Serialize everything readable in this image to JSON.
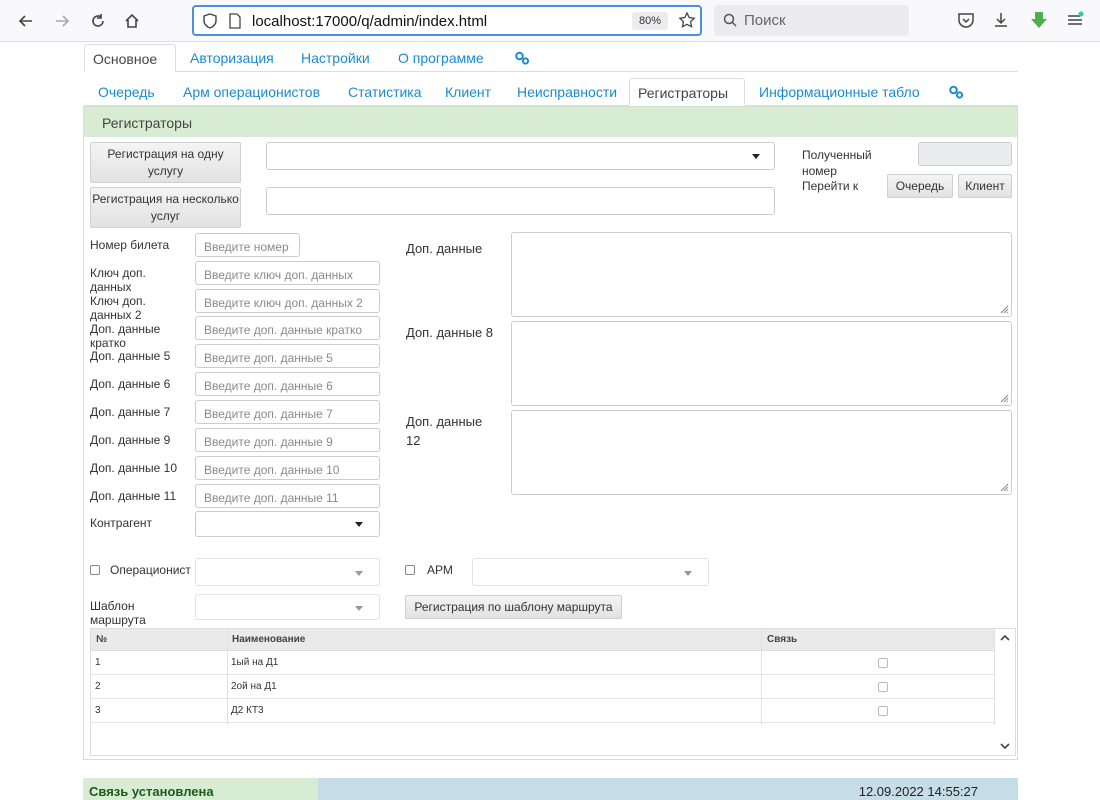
{
  "browser": {
    "url": "localhost:17000/q/admin/index.html",
    "zoom": "80%",
    "search_placeholder": "Поиск"
  },
  "tabs_main": [
    {
      "label": "Основное",
      "active": true
    },
    {
      "label": "Авторизация"
    },
    {
      "label": "Настройки"
    },
    {
      "label": "О программе"
    }
  ],
  "tabs_sub": [
    {
      "label": "Очередь"
    },
    {
      "label": "Арм операционистов"
    },
    {
      "label": "Статистика"
    },
    {
      "label": "Клиент"
    },
    {
      "label": "Неисправности"
    },
    {
      "label": "Регистраторы",
      "active": true
    },
    {
      "label": "Информационные табло"
    }
  ],
  "panel": {
    "title": "Регистраторы",
    "btn_single": "Регистрация на одну услугу",
    "btn_multi": "Регистрация на несколько услуг",
    "received_number_label": "Полученный номер",
    "goto_label": "Перейти к",
    "btn_queue": "Очередь",
    "btn_client": "Клиент",
    "fields": [
      {
        "label": "Номер билета",
        "placeholder": "Введите номер"
      },
      {
        "label": "Ключ доп. данных",
        "placeholder": "Введите ключ доп. данных"
      },
      {
        "label": "Ключ доп. данных 2",
        "placeholder": "Введите ключ доп. данных 2"
      },
      {
        "label": "Доп. данные кратко",
        "placeholder": "Введите доп. данные кратко"
      },
      {
        "label": "Доп. данные 5",
        "placeholder": "Введите доп. данные 5"
      },
      {
        "label": "Доп. данные 6",
        "placeholder": "Введите доп. данные 6"
      },
      {
        "label": "Доп. данные 7",
        "placeholder": "Введите доп. данные 7"
      },
      {
        "label": "Доп. данные 9",
        "placeholder": "Введите доп. данные 9"
      },
      {
        "label": "Доп. данные 10",
        "placeholder": "Введите доп. данные 10"
      },
      {
        "label": "Доп. данные 11",
        "placeholder": "Введите доп. данные 11"
      }
    ],
    "contractor_label": "Контрагент",
    "textareas": [
      {
        "label": "Доп. данные"
      },
      {
        "label": "Доп. данные 8"
      },
      {
        "label": "Доп. данные 12"
      }
    ],
    "operator_label": "Операционист",
    "arm_label": "АРМ",
    "route_template_label": "Шаблон маршрута",
    "btn_route": "Регистрация по шаблону маршрута"
  },
  "grid": {
    "headers": [
      "№",
      "Наименование",
      "Связь"
    ],
    "rows": [
      {
        "num": "1",
        "name": "1ый на Д1"
      },
      {
        "num": "2",
        "name": "2ой на Д1"
      },
      {
        "num": "3",
        "name": "Д2 КТ3"
      }
    ]
  },
  "status": {
    "connection": "Связь установлена",
    "datetime": "12.09.2022 14:55:27"
  }
}
